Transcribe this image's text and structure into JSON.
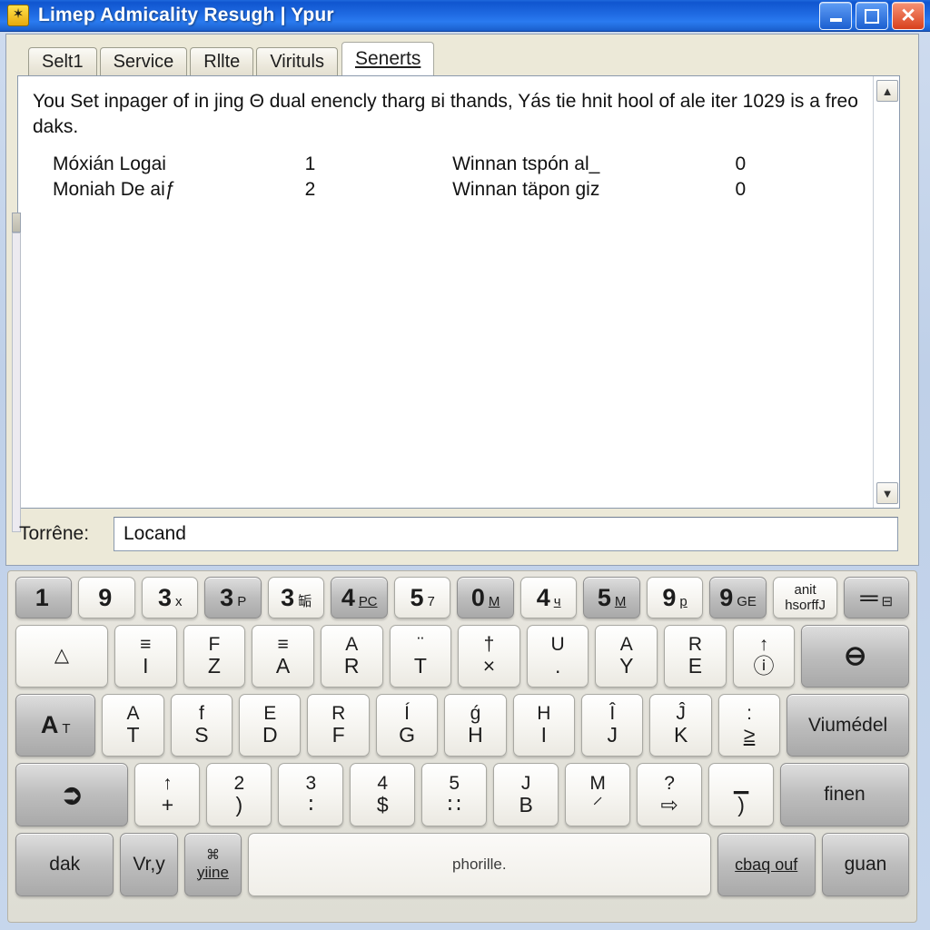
{
  "window": {
    "title": "Limep Admicality Resugh | Ypur",
    "icon": "star-app-icon",
    "controls": {
      "minimize": "minimize-button",
      "maximize": "maximize-button",
      "close": "close-button"
    }
  },
  "tabs": [
    {
      "label": "Selt1",
      "active": false
    },
    {
      "label": "Service",
      "active": false
    },
    {
      "label": "Rllte",
      "active": false
    },
    {
      "label": "Virituls",
      "active": false
    },
    {
      "label": "Senerts",
      "active": true
    }
  ],
  "content": {
    "paragraph": "You Set inpager of in jing Θ dual enencly tharg вi thands, Yás tie hnit hool of ale iter 1029 is a freo daks.",
    "rows": [
      {
        "label_left": "Móxián Logai",
        "value_left": "1",
        "label_right": "Winnan tspón al_",
        "value_right": "0"
      },
      {
        "label_left": "Moniah De aiƒ",
        "value_left": "2",
        "label_right": "Winnan täpon giz",
        "value_right": "0"
      }
    ],
    "scroll_up": "▲",
    "scroll_down": "▼"
  },
  "field": {
    "label": "Torrêne:",
    "value": "Locand"
  },
  "keyboard": {
    "row1": [
      {
        "main": "1",
        "sub": "",
        "dark": true
      },
      {
        "main": "9",
        "sub": "",
        "dark": false
      },
      {
        "main": "3",
        "sub": "х",
        "dark": false
      },
      {
        "main": "3",
        "sub": "P",
        "dark": true
      },
      {
        "main": "3",
        "sub": "缿",
        "dark": false
      },
      {
        "main": "4",
        "sub": "РС",
        "dark": true,
        "underline": true
      },
      {
        "main": "5",
        "sub": "7",
        "dark": false
      },
      {
        "main": "0",
        "sub": "M",
        "dark": true,
        "underline": true
      },
      {
        "main": "4",
        "sub": "ч",
        "dark": false,
        "underline": true
      },
      {
        "main": "5",
        "sub": "M",
        "dark": true,
        "underline": true
      },
      {
        "main": "9",
        "sub": "р",
        "dark": false,
        "underline": true
      },
      {
        "main": "9",
        "sub": "GE",
        "dark": true
      },
      {
        "word": "anit\nhsorffJ",
        "dark": false
      },
      {
        "main": "═",
        "sub": "⊟",
        "dark": true
      }
    ],
    "row2": [
      {
        "top": "△",
        "bot": "",
        "dark": false,
        "wide": "w-150"
      },
      {
        "top": "≡",
        "bot": "I",
        "dark": false
      },
      {
        "top": "F",
        "bot": "Z",
        "dark": false
      },
      {
        "top": "≡",
        "bot": "A",
        "dark": false
      },
      {
        "top": "A",
        "bot": "R",
        "dark": false
      },
      {
        "top": "̈",
        "bot": "T",
        "dark": false
      },
      {
        "top": "†",
        "bot": "×",
        "dark": false
      },
      {
        "top": "U",
        "bot": ".",
        "dark": false
      },
      {
        "top": "A",
        "bot": "Y",
        "dark": false
      },
      {
        "top": "R",
        "bot": "E",
        "dark": false
      },
      {
        "top": "↑",
        "bot": "ⓘ",
        "dark": false
      },
      {
        "top": "⚫",
        "bot": "",
        "dark": true,
        "wide": "w-175",
        "glyph": "⊖"
      }
    ],
    "row3": [
      {
        "top": "A",
        "bot": "T",
        "dark": true,
        "wide": "w-130",
        "inline": true
      },
      {
        "top": "A",
        "bot": "T",
        "dark": false
      },
      {
        "top": "f",
        "bot": "S",
        "dark": false
      },
      {
        "top": "E",
        "bot": "D",
        "dark": false
      },
      {
        "top": "R",
        "bot": "F",
        "dark": false
      },
      {
        "top": "Í",
        "bot": "G",
        "dark": false
      },
      {
        "top": "ǵ",
        "bot": "H",
        "dark": false
      },
      {
        "top": "H",
        "bot": "I",
        "dark": false
      },
      {
        "top": "Î",
        "bot": "J",
        "dark": false
      },
      {
        "top": "Ĵ",
        "bot": "K",
        "dark": false
      },
      {
        "top": ":",
        "bot": "≥",
        "dark": false
      },
      {
        "word": "Viumédel",
        "dark": true,
        "wide": "w-200"
      }
    ],
    "row4": [
      {
        "word": "➲",
        "dark": true,
        "wide": "w-175",
        "glyph": true
      },
      {
        "top": "↑",
        "bot": "+",
        "dark": false
      },
      {
        "top": "2",
        "bot": ")",
        "dark": false
      },
      {
        "top": "3",
        "bot": "∶",
        "dark": false
      },
      {
        "top": "4",
        "bot": "$",
        "dark": false
      },
      {
        "top": "5",
        "bot": "∷",
        "dark": false
      },
      {
        "top": "J",
        "bot": "B",
        "dark": false
      },
      {
        "top": "M",
        "bot": "⸍",
        "dark": false
      },
      {
        "top": "?",
        "bot": "⇨",
        "dark": false
      },
      {
        "top": "▁",
        "bot": ")",
        "dark": false
      },
      {
        "word": "finen",
        "dark": true,
        "wide": "w-200"
      }
    ],
    "row5": [
      {
        "word": "dak",
        "dark": true,
        "wide": "w-130"
      },
      {
        "word": "Vr,y",
        "dark": true,
        "wide": "w-small"
      },
      {
        "top": "⌘",
        "bot": "yiine",
        "dark": true,
        "wide": "w-small"
      },
      {
        "word": "phorille.",
        "dark": false,
        "space": true
      },
      {
        "word": "cbaq ouf",
        "dark": true,
        "wide": "w-130",
        "underline": true
      },
      {
        "word": "guan",
        "dark": true,
        "wide": "w-115"
      }
    ]
  }
}
